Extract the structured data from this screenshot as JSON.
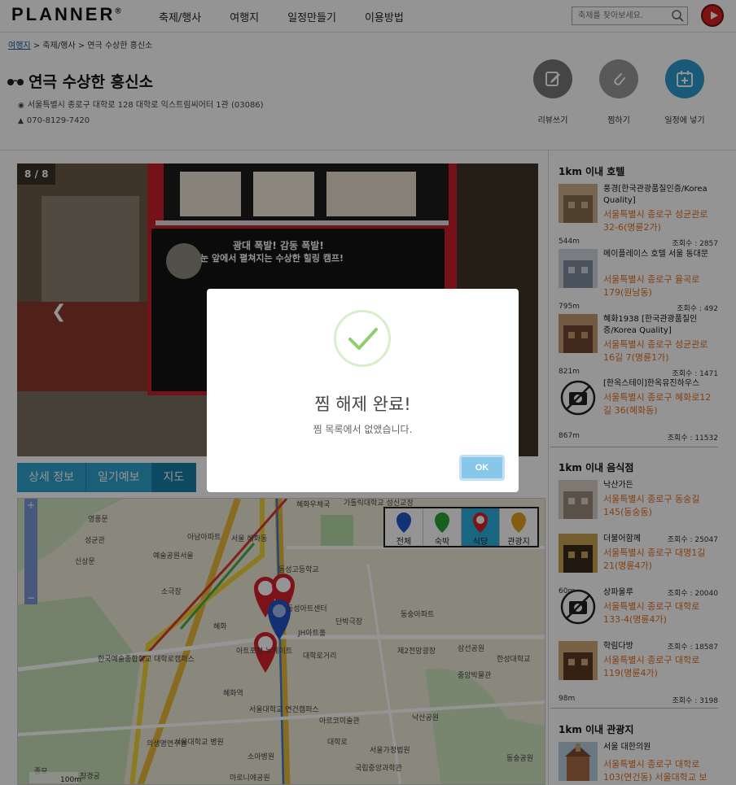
{
  "header": {
    "logo": "PLANNER",
    "logo_mark": "®",
    "nav": [
      "축제/행사",
      "여행지",
      "일정만들기",
      "이용방법"
    ],
    "search_placeholder": "축제를 찾아보세요."
  },
  "breadcrumb": {
    "home": "여행지",
    "category": "축제/행사",
    "current": "연극 수상한 흥신소"
  },
  "place": {
    "title": "연극 수상한 흥신소",
    "address": "서울특별시 종로구 대학로 128 대학로 익스트림씨어터 1관 (03086)",
    "phone": "070-8129-7420"
  },
  "actions": [
    {
      "label": "리뷰쓰기",
      "icon": "edit-icon"
    },
    {
      "label": "찜하기",
      "icon": "paperclip-icon"
    },
    {
      "label": "일정에 넣기",
      "icon": "calendar-add-icon"
    }
  ],
  "gallery": {
    "counter": "8 / 8",
    "poster_line1": "광대 폭발! 감동 폭발!",
    "poster_line2": "눈 앞에서 펼쳐지는 수상한 힐링 캠프!"
  },
  "tabs": [
    "상세 정보",
    "일기예보",
    "지도"
  ],
  "map": {
    "filters": [
      "전체",
      "숙박",
      "식당",
      "관광지"
    ],
    "active_filter": "식당",
    "labels": [
      "혜화우체국",
      "가톨릭대학교 성신교정",
      "영풍문",
      "아남아파트",
      "서울 혜화동",
      "예술공원서울",
      "동성고등학교",
      "소극장",
      "동성아트센터",
      "단박극장",
      "JH아트홀",
      "동숭아파트",
      "아트포럼 뉴게이트",
      "대학로거리",
      "제2전망광장",
      "삼선공원",
      "한성대학교",
      "한국예술종합학교 대학로캠퍼스",
      "혜화역",
      "서울대학교 연건캠퍼스",
      "아르코미술관",
      "서울대학교 병원",
      "소아병원",
      "대학로",
      "낙산공원",
      "국립중앙과학관",
      "창경궁",
      "종묘",
      "의생명연구원",
      "서울가정법원",
      "마로니에공원",
      "혜화",
      "중앙박물관",
      "동숭공원",
      "성균관",
      "신상문"
    ],
    "scale": "100m"
  },
  "sidebar": {
    "hotels_title": "1km 이내 호텔",
    "hotels": [
      {
        "name": "풍경[한국관광품질인증/Korea Quality]",
        "address": "서울특별시 종로구 성균관로 32-6(명륜2가)",
        "distance": "544m",
        "views": "조회수 : 2857"
      },
      {
        "name": "메이플레이스 호텔 서울 동대문",
        "address": "서울특별시 종로구 율곡로 179(원남동)",
        "distance": "795m",
        "views": "조회수 : 492"
      },
      {
        "name": "혜화1938 [한국관광품질인증/Korea Quality]",
        "address": "서울특별시 종로구 성균관로16길 7(명륜1가)",
        "distance": "821m",
        "views": "조회수 : 1471"
      },
      {
        "name": "[한옥스테이]한옥유진하우스",
        "address": "서울특별시 종로구 혜화로12길 36(혜화동)",
        "distance": "867m",
        "views": "조회수 : 11532"
      }
    ],
    "food_title": "1km 이내 음식점",
    "food": [
      {
        "name": "낙산가든",
        "address": "서울특별시 종로구 동숭길 145(동숭동)",
        "distance": "55m",
        "views": "조회수 : 25047"
      },
      {
        "name": "더불어함께",
        "address": "서울특별시 종로구 대명1길 21(명륜4가)",
        "distance": "60m",
        "views": "조회수 : 20040"
      },
      {
        "name": "상파울루",
        "address": "서울특별시 종로구 대학로 133-4(명륜4가)",
        "distance": "85m",
        "views": "조회수 : 18587"
      },
      {
        "name": "학림다방",
        "address": "서울특별시 종로구 대학로 119(명륜4가)",
        "distance": "98m",
        "views": "조회수 : 3198"
      }
    ],
    "sights_title": "1km 이내 관광지",
    "sights": [
      {
        "name": "서울 대한의원",
        "address": "서울특별시 종로구 대학로 103(연건동) 서울대학교 보"
      }
    ]
  },
  "modal": {
    "title": "찜 해제 완료!",
    "text": "찜 목록에서 없앴습니다.",
    "ok": "OK"
  }
}
